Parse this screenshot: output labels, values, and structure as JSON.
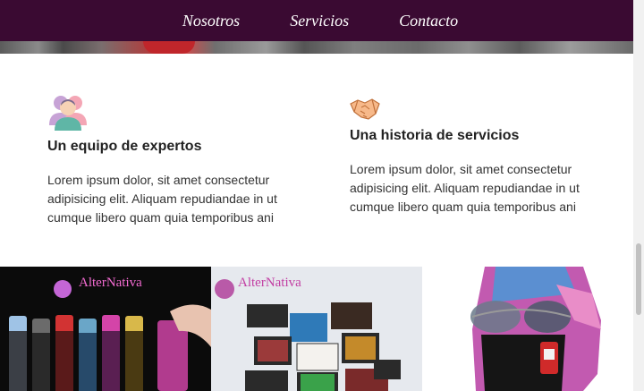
{
  "nav": {
    "items": [
      {
        "label": "Nosotros"
      },
      {
        "label": "Servicios"
      },
      {
        "label": "Contacto"
      }
    ]
  },
  "features": [
    {
      "icon": "team-icon",
      "title": "Un equipo de expertos",
      "text": "Lorem ipsum dolor, sit amet consectetur adipisicing elit. Aliquam repudiandae in ut cumque libero quam quia temporibus ani"
    },
    {
      "icon": "handshake-icon",
      "title": "Una historia de servicios",
      "text": "Lorem ipsum dolor, sit amet consectetur adipisicing elit. Aliquam repudiandae in ut cumque libero quam quia temporibus ani"
    }
  ],
  "gallery": {
    "tiles": [
      {
        "brand": "AlterNativa",
        "subject": "hair-spray-cans-image"
      },
      {
        "brand": "AlterNativa",
        "subject": "eyeshadow-palettes-image"
      },
      {
        "brand": "",
        "subject": "mannequin-with-sunglasses-image"
      }
    ]
  },
  "colors": {
    "nav_bg": "#3a0a32",
    "brand_pink": "#e44fb9"
  }
}
